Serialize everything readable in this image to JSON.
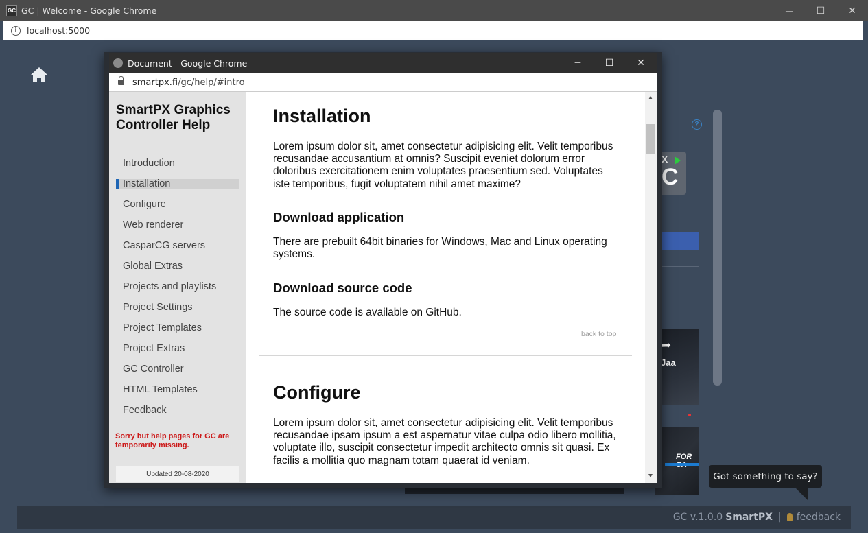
{
  "outer_window": {
    "app_icon_text": "GC",
    "title": "GC | Welcome - Google Chrome",
    "url": "localhost:5000",
    "controls": {
      "minimize": "─",
      "maximize": "☐",
      "close": "✕"
    }
  },
  "app": {
    "help_icon": "?",
    "logo_letters": {
      "x": "X",
      "c": "C"
    },
    "video1_caption": "Jaa",
    "video2_caption": "FOR CA",
    "tooltip": "Got something to say?",
    "footer": {
      "version": "GC v.1.0.0",
      "brand": "SmartPX",
      "separator": "|",
      "feedback": "feedback"
    }
  },
  "popup": {
    "title": "Document - Google Chrome",
    "url_host": "smartpx.fi",
    "url_path": "/gc/help/#intro",
    "controls": {
      "minimize": "─",
      "maximize": "☐",
      "close": "✕"
    },
    "sidebar": {
      "title": "SmartPX Graphics Controller Help",
      "items": [
        {
          "label": "Introduction"
        },
        {
          "label": "Installation",
          "active": true
        },
        {
          "label": "Configure"
        },
        {
          "label": "Web renderer"
        },
        {
          "label": "CasparCG servers"
        },
        {
          "label": "Global Extras"
        },
        {
          "label": "Projects and playlists"
        },
        {
          "label": "Project Settings"
        },
        {
          "label": "Project Templates"
        },
        {
          "label": "Project Extras"
        },
        {
          "label": "GC Controller"
        },
        {
          "label": "HTML Templates"
        },
        {
          "label": "Feedback"
        }
      ],
      "missing_notice": "Sorry but help pages for GC are temporarily missing.",
      "updated": "Updated 20-08-2020"
    },
    "content": {
      "installation": {
        "heading": "Installation",
        "body": "Lorem ipsum dolor sit, amet consectetur adipisicing elit. Velit temporibus recusandae accusantium at omnis? Suscipit eveniet dolorum error doloribus exercitationem enim voluptates praesentium sed. Voluptates iste temporibus, fugit voluptatem nihil amet maxime?"
      },
      "download_app": {
        "heading": "Download application",
        "body": "There are prebuilt 64bit binaries for Windows, Mac and Linux operating systems."
      },
      "download_source": {
        "heading": "Download source code",
        "body": "The source code is available on GitHub."
      },
      "back_to_top": "back to top",
      "configure": {
        "heading": "Configure",
        "body": "Lorem ipsum dolor sit, amet consectetur adipisicing elit. Velit temporibus recusandae ipsam ipsum a est aspernatur vitae culpa odio libero mollitia, voluptate illo, suscipit consectetur impedit architecto omnis sit quasi. Ex facilis a mollitia quo magnam totam quaerat id veniam."
      }
    }
  }
}
